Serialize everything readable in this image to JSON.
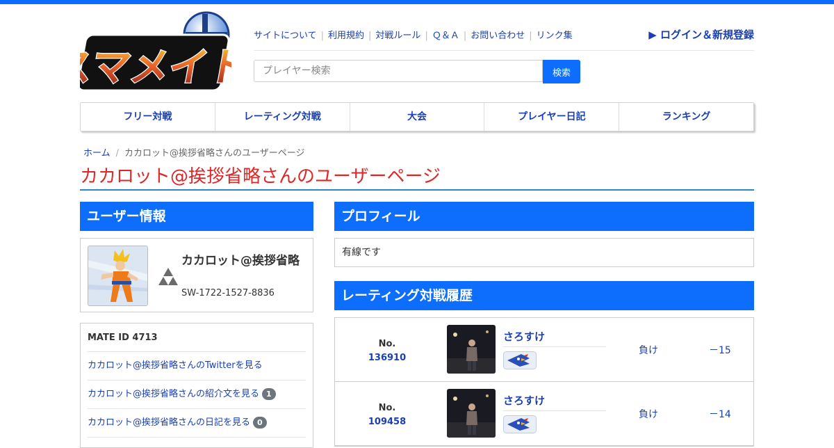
{
  "header": {
    "logo_text": "スマメイト",
    "links": [
      "サイトについて",
      "利用規約",
      "対戦ルール",
      "Ｑ＆Ａ",
      "お問い合わせ",
      "リンク集"
    ],
    "login": "▶ ログイン＆新規登録",
    "search_placeholder": "プレイヤー検索",
    "search_button": "検索"
  },
  "nav": [
    "フリー対戦",
    "レーティング対戦",
    "大会",
    "プレイヤー日記",
    "ランキング"
  ],
  "breadcrumb": {
    "home": "ホーム",
    "current": "カカロット@挨拶省略さんのユーザーページ"
  },
  "page_title": "カカロット@挨拶省略さんのユーザーページ",
  "user_info": {
    "heading": "ユーザー情報",
    "name": "カカロット@挨拶省略",
    "friend_code": "SW-1722-1527-8836",
    "mate_id": "MATE ID 4713",
    "links": [
      {
        "label": "カカロット@挨拶省略さんのTwitterを見る",
        "badge": ""
      },
      {
        "label": "カカロット@挨拶省略さんの紹介文を見る",
        "badge": "1"
      },
      {
        "label": "カカロット@挨拶省略さんの日記を見る",
        "badge": "0"
      }
    ]
  },
  "profile": {
    "heading": "プロフィール",
    "text": "有線です"
  },
  "history": {
    "heading": "レーティング対戦履歴",
    "no_label": "No.",
    "matches": [
      {
        "no": "136910",
        "opponent": "さろすけ",
        "result": "負け",
        "score": "－15"
      },
      {
        "no": "109458",
        "opponent": "さろすけ",
        "result": "負け",
        "score": "－14"
      }
    ]
  },
  "colors": {
    "accent": "#0d6efd",
    "title_red": "#e02727",
    "link": "#1a3fb0"
  }
}
